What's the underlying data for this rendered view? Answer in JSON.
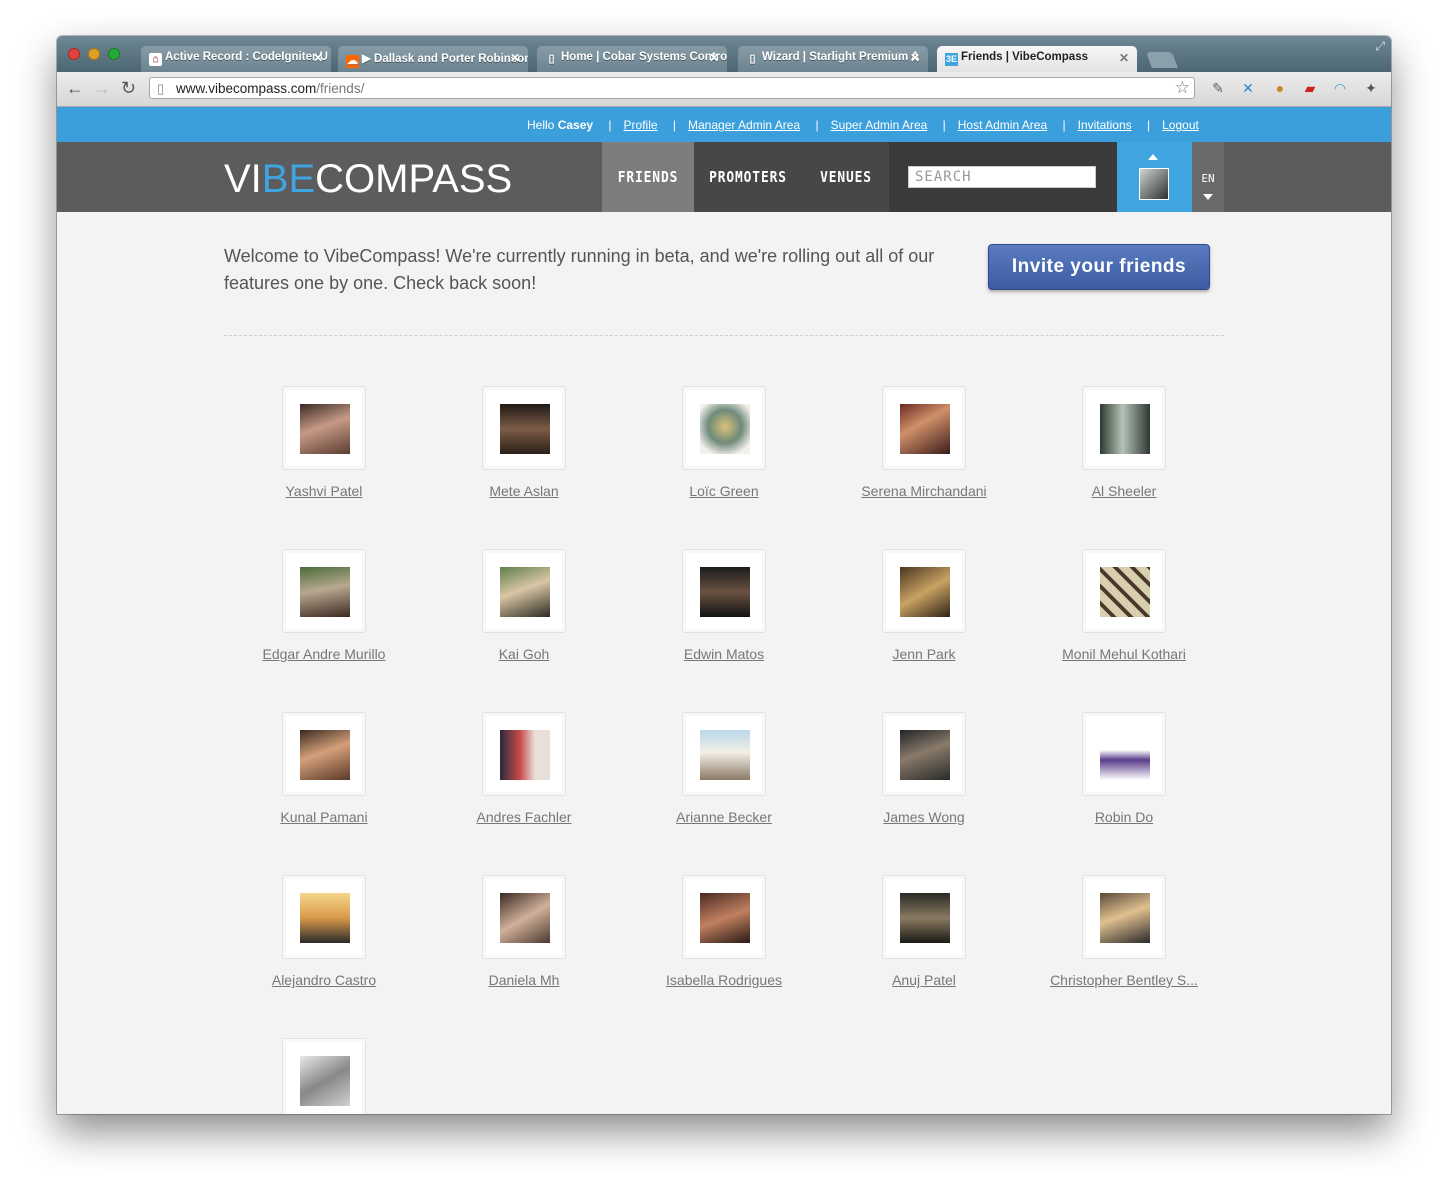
{
  "browser": {
    "tabs": [
      {
        "title": "Active Record : CodeIgniter U",
        "icon": "codeigniter-icon"
      },
      {
        "title": "▶ Dallask and Porter Robinson",
        "icon": "soundcloud-icon"
      },
      {
        "title": "Home | Cobar Systems Contro",
        "icon": "page-icon"
      },
      {
        "title": "Wizard | Starlight Premium A",
        "icon": "page-icon"
      },
      {
        "title": "Friends | VibeCompass",
        "icon": "vibecompass-icon"
      }
    ],
    "url_host": "www.vibecompass.com",
    "url_path": "/friends/"
  },
  "userbar": {
    "greeting": "Hello ",
    "username": "Casey",
    "links": [
      "Profile",
      "Manager Admin Area",
      "Super Admin Area",
      "Host Admin Area",
      "Invitations",
      "Logout"
    ]
  },
  "header": {
    "logo_vi": "VI",
    "logo_be": "BE",
    "logo_compass": "COMPASS",
    "nav": [
      "FRIENDS",
      "PROMOTERS",
      "VENUES"
    ],
    "search_placeholder": "SEARCH",
    "language": "EN"
  },
  "main": {
    "welcome_text": "Welcome to VibeCompass! We're currently running in beta, and we're rolling out all of our features one by one. Check back soon!",
    "invite_label": "Invite your friends"
  },
  "friends": [
    "Yashvi Patel",
    "Mete Aslan",
    "Loïc Green",
    "Serena Mirchandani",
    "Al Sheeler",
    "Edgar Andre Murillo",
    "Kai Goh",
    "Edwin Matos",
    "Jenn Park",
    "Monil Mehul Kothari",
    "Kunal Pamani",
    "Andres Fachler",
    "Arianne Becker",
    "James Wong",
    "Robin Do",
    "Alejandro Castro",
    "Daniela Mh",
    "Isabella Rodrigues",
    "Anuj Patel",
    "Christopher Bentley S...",
    ""
  ],
  "colors": {
    "accent_blue": "#3b9fdb",
    "header_gray": "#5c5c5c",
    "invite_button": "#4a6ab2"
  }
}
